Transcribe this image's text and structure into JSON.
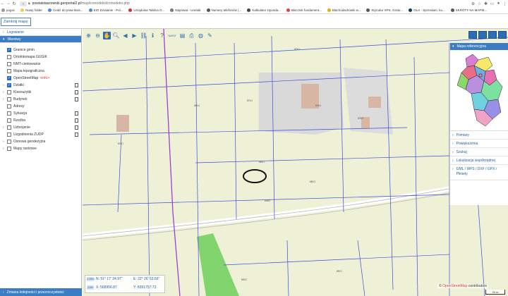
{
  "browser": {
    "url_host": "powiatstaszowski.geoportal2.pl",
    "url_path": "/map/iconodeko/iconodeko.php",
    "bookmarks": [
      {
        "label": "pogoc",
        "color": "#9a9a9a"
      },
      {
        "label": "Nowy folder",
        "color": "#f2c94c"
      },
      {
        "label": "Ceidż do praw Bois...",
        "color": "#4a8ad6"
      },
      {
        "label": "EIO Dzialanie - Pol...",
        "color": "#4a8ad6"
      },
      {
        "label": "Urządowa Tabilca O...",
        "color": "#c33"
      },
      {
        "label": "Naprawa - Uonlab",
        "color": "#777"
      },
      {
        "label": "Numery telefonów (...",
        "color": "#555"
      },
      {
        "label": "Kalkulator Hyunda...",
        "color": "#444"
      },
      {
        "label": "Błocznik fundament...",
        "color": "#d44"
      },
      {
        "label": "Blachodachówki w...",
        "color": "#e2b010"
      },
      {
        "label": "Styrodur XPS, Gratu...",
        "color": "#555"
      },
      {
        "label": "OLX - Sprzedam, ku...",
        "color": "#0b3d5c"
      },
      {
        "label": "SKRÓTY NA MAPIE...",
        "color": "#555"
      }
    ]
  },
  "app": {
    "close_map_label": "Zamknij mapę"
  },
  "sidebar": {
    "login_label": "Logowanie",
    "layers_label": "Warstwy",
    "layers": [
      {
        "label": "Granice gmin",
        "checked": true,
        "expandable": false,
        "doc": false
      },
      {
        "label": "Ortofotomapa GUGiK",
        "checked": false,
        "expandable": false,
        "doc": false
      },
      {
        "label": "NMT-cieniowanie",
        "checked": false,
        "expandable": false,
        "doc": false
      },
      {
        "label": "Mapa topograficzna",
        "checked": false,
        "expandable": false,
        "doc": false
      },
      {
        "label": "OpenStreetMap",
        "info": "<info>",
        "checked": true,
        "expandable": false,
        "doc": false
      },
      {
        "label": "Działki",
        "checked": true,
        "expandable": true,
        "doc": true
      },
      {
        "label": "Klasoużytki",
        "checked": false,
        "expandable": true,
        "doc": true
      },
      {
        "label": "Budynek",
        "checked": false,
        "expandable": true,
        "doc": true
      },
      {
        "label": "Adresy",
        "checked": false,
        "expandable": false,
        "doc": false
      },
      {
        "label": "Sytuacja",
        "checked": false,
        "expandable": false,
        "doc": true
      },
      {
        "label": "Rzeźba",
        "checked": false,
        "expandable": false,
        "doc": true
      },
      {
        "label": "Uzbrojenie",
        "checked": false,
        "expandable": true,
        "doc": true
      },
      {
        "label": "Uzgodnienia ZUDP",
        "checked": false,
        "expandable": false,
        "doc": true
      },
      {
        "label": "Osnowa geodezyjna",
        "checked": false,
        "expandable": true,
        "doc": false
      },
      {
        "label": "Mapy rastrowe",
        "checked": false,
        "expandable": true,
        "doc": false
      }
    ],
    "footer_label": "Zmiana kolejności i przezroczystości"
  },
  "map": {
    "tools": [
      "zoom-in",
      "zoom-out",
      "pan",
      "zoom-box",
      "back",
      "forward",
      "link",
      "info",
      "help",
      "measure",
      "print-preview",
      "print",
      "globe",
      "edit"
    ],
    "tool_small_label": "NARZ",
    "right_panel": {
      "header": "Mapa referencyjna",
      "items": [
        "Pomiary",
        "Powiększenia",
        "Szukaj",
        "Lokalizacja współrzędnej",
        "GML / WFS / DXF / GPX / Pliniety"
      ]
    },
    "coords": {
      "scale_tag": "1:2500",
      "epsg_tag": "2180",
      "n_label": "N:",
      "n_value": "51° 17' 24.97\"",
      "e_label": "E:",
      "e_value": "22° 26' 53.66\"",
      "x_label": "X:",
      "x_value": "568956.87",
      "y_label": "Y:",
      "y_value": "8391757.73"
    },
    "attribution_prefix": "©",
    "attribution_name": "OpenStreetMap",
    "attribution_suffix": "contributors",
    "scale_label": "20 m",
    "parcel_labels": [
      "875/1",
      "878/4",
      "878/3",
      "879/1",
      "880/4",
      "893/2",
      "876/1",
      "881/1",
      "880/3",
      "890/2",
      "890/1",
      "888/1"
    ],
    "colors": {
      "parcel_line": "#3d4bdc",
      "boundary": "#9b3fd4",
      "building": "#d7b7a4",
      "industrial": "#dcdcdc",
      "green": "#6fcf5c"
    }
  }
}
